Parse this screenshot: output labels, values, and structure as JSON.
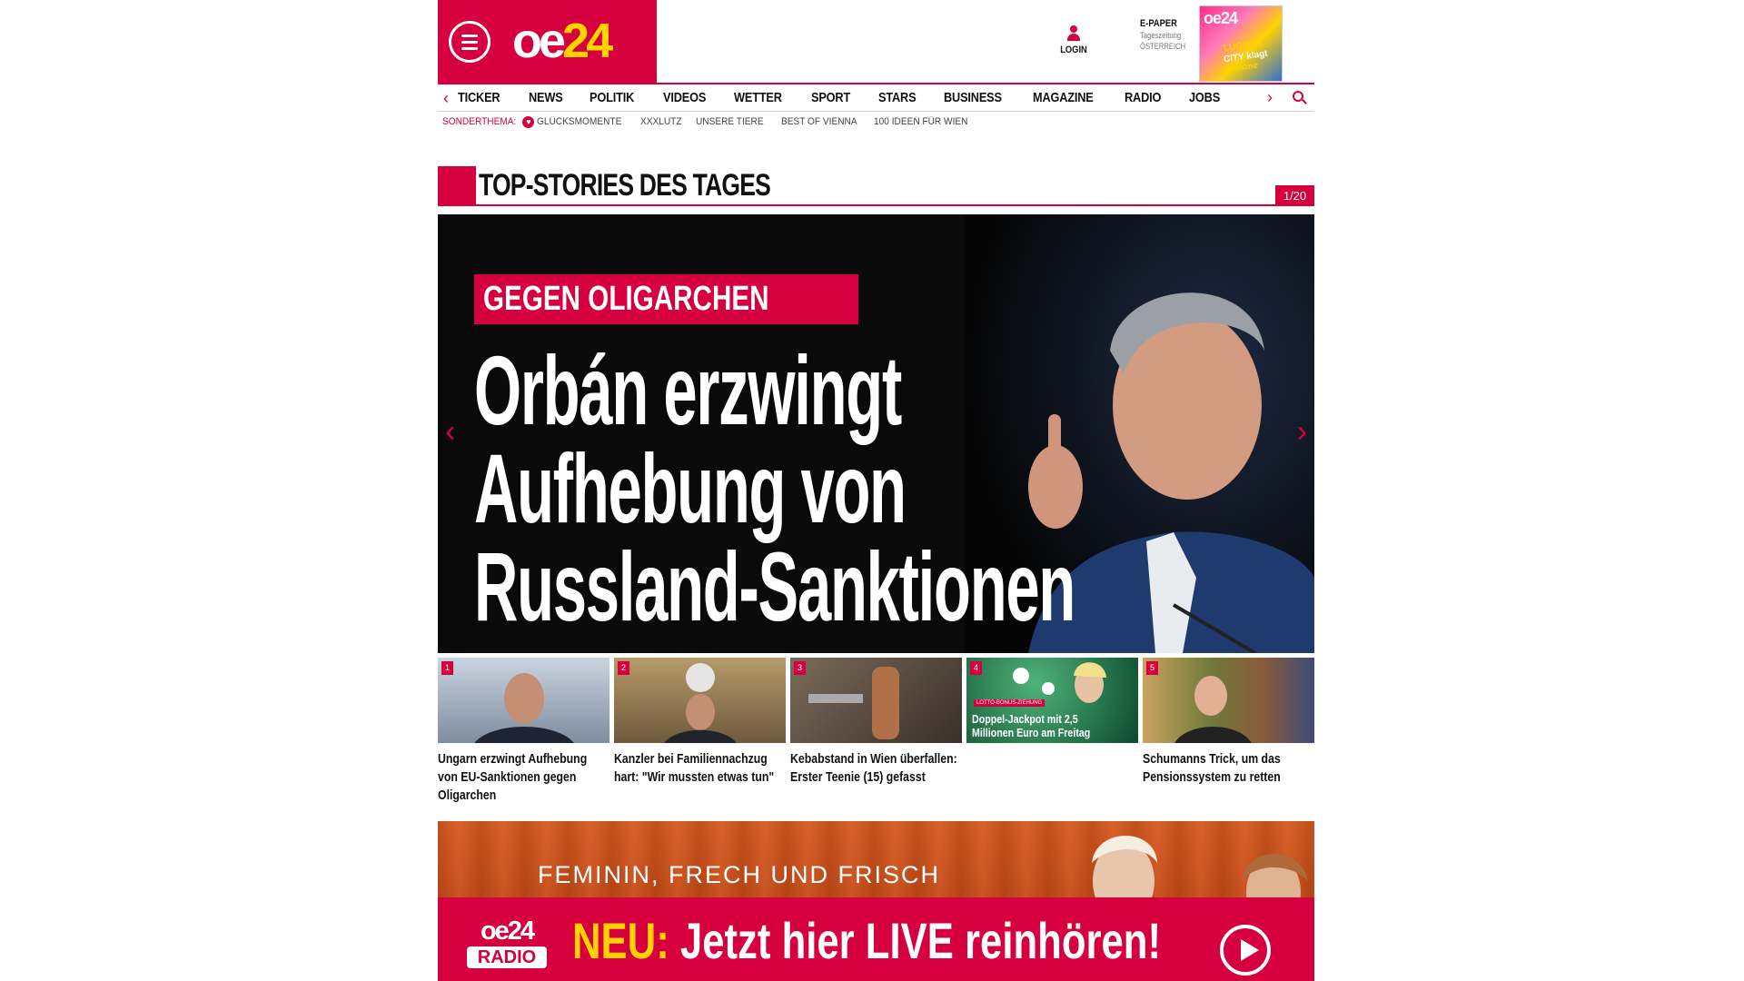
{
  "header": {
    "logo_main": "oe",
    "logo_num": "24",
    "login_label": "LOGIN",
    "epaper_title": "E-PAPER",
    "epaper_sub1": "Tageszeitung",
    "epaper_sub2": "ÖSTERREICH",
    "epaper_cover_logo": "oe24",
    "epaper_cover_h1": "LUGNER",
    "epaper_cover_h2": "CITY klagt",
    "epaper_cover_h3": "Simone"
  },
  "nav": {
    "items": [
      "TICKER",
      "NEWS",
      "POLITIK",
      "VIDEOS",
      "WETTER",
      "SPORT",
      "STARS",
      "BUSINESS",
      "MAGAZINE",
      "RADIO",
      "JOBS"
    ],
    "left_arrow": "‹",
    "right_arrow": "›"
  },
  "subnav": {
    "label": "SONDERTHEMA:",
    "items": [
      "GLÜCKSMOMENTE",
      "XXXLUTZ",
      "UNSERE TIERE",
      "BEST OF VIENNA",
      "100 IDEEN FÜR WIEN"
    ]
  },
  "section": {
    "title": "TOP-STORIES DES TAGES",
    "counter": "1/20"
  },
  "hero": {
    "kicker": "GEGEN OLIGARCHEN",
    "headline_lines": [
      "Orbán erzwingt",
      "Aufhebung von",
      "Russland-Sanktionen"
    ],
    "arrow_left": "‹",
    "arrow_right": "›"
  },
  "teasers": [
    {
      "num": "1",
      "caption": "Ungarn erzwingt Aufhebung von EU-Sanktionen gegen Oligarchen"
    },
    {
      "num": "2",
      "caption": "Kanzler bei Familiennachzug hart: \"Wir mussten etwas tun\""
    },
    {
      "num": "3",
      "caption": "Kebabstand in Wien überfallen: Erster Teenie (15) gefasst"
    },
    {
      "num": "4",
      "caption": "",
      "thumb_tag": "LOTTO-BONUS-ZIEHUNG",
      "thumb_overlay": "Doppel-Jackpot mit 2,5 Millionen Euro am Freitag"
    },
    {
      "num": "5",
      "caption": "Schumanns Trick, um das Pensionssystem zu retten"
    }
  ],
  "banner": {
    "tagline": "FEMININ, FRECH UND FRISCH",
    "radio_logo_top": "oe24",
    "radio_logo_bottom": "RADIO",
    "cta_neu": "NEU:",
    "cta_text": " Jetzt hier LIVE reinhören!"
  },
  "colors": {
    "brand_red": "#d6003e",
    "accent_yellow": "#ffd200"
  }
}
